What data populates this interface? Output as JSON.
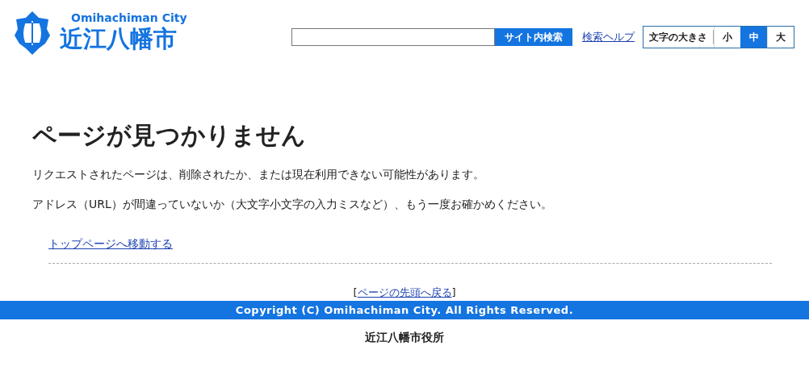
{
  "header": {
    "logo_subtitle": "Omihachiman City",
    "logo_title": "近江八幡市",
    "search": {
      "button": "サイト内検索"
    },
    "search_help": "検索ヘルプ",
    "font_size": {
      "label": "文字の大きさ",
      "options": [
        {
          "label": "小",
          "selected": false
        },
        {
          "label": "中",
          "selected": true
        },
        {
          "label": "大",
          "selected": false
        }
      ]
    }
  },
  "main": {
    "heading": "ページが見つかりません",
    "paragraphs": [
      "リクエストされたページは、削除されたか、または現在利用できない可能性があります。",
      "アドレス（URL）が間違っていないか（大文字小文字の入力ミスなど）、もう一度お確かめください。"
    ],
    "top_link": "トップページへ移動する"
  },
  "back_to_top": {
    "open": "[",
    "link": "ページの先頭へ戻る",
    "close": "]"
  },
  "footer": {
    "copyright": "Copyright (C) Omihachiman City. All Rights Reserved.",
    "office": "近江八幡市役所"
  }
}
